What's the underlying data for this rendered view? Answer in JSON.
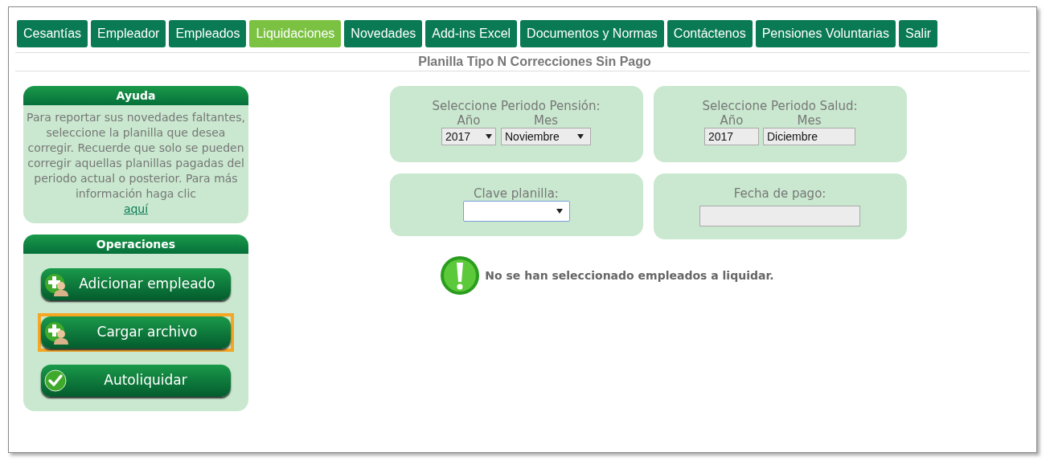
{
  "tabs": [
    {
      "label": "Cesantías",
      "selected": false
    },
    {
      "label": "Empleador",
      "selected": false
    },
    {
      "label": "Empleados",
      "selected": false
    },
    {
      "label": "Liquidaciones",
      "selected": true
    },
    {
      "label": "Novedades",
      "selected": false
    },
    {
      "label": "Add-ins Excel",
      "selected": false
    },
    {
      "label": "Documentos y Normas",
      "selected": false
    },
    {
      "label": "Contáctenos",
      "selected": false
    },
    {
      "label": "Pensiones Voluntarias",
      "selected": false
    },
    {
      "label": "Salir",
      "selected": false
    }
  ],
  "page_title": "Planilla Tipo N Correcciones Sin Pago",
  "help": {
    "title": "Ayuda",
    "text": "Para reportar sus novedades faltantes, seleccione la planilla que desea corregir. Recuerde que solo se pueden corregir aquellas planillas pagadas del periodo actual o posterior. Para más información haga clic",
    "link": "aquí"
  },
  "operations": {
    "title": "Operaciones",
    "buttons": [
      {
        "label": "Adicionar empleado",
        "kind": "add",
        "highlighted": false
      },
      {
        "label": "Cargar archivo",
        "kind": "add",
        "highlighted": true
      },
      {
        "label": "Autoliquidar",
        "kind": "check",
        "highlighted": false
      }
    ]
  },
  "pension_period": {
    "title": "Seleccione Periodo Pensión:",
    "year_label": "Año",
    "month_label": "Mes",
    "year": "2017",
    "month": "Noviembre"
  },
  "health_period": {
    "title": "Seleccione Periodo Salud:",
    "year_label": "Año",
    "month_label": "Mes",
    "year": "2017",
    "month": "Diciembre"
  },
  "form_key": {
    "label": "Clave planilla:"
  },
  "payment_date": {
    "label": "Fecha de pago:"
  },
  "message": "No se han seleccionado empleados a liquidar."
}
